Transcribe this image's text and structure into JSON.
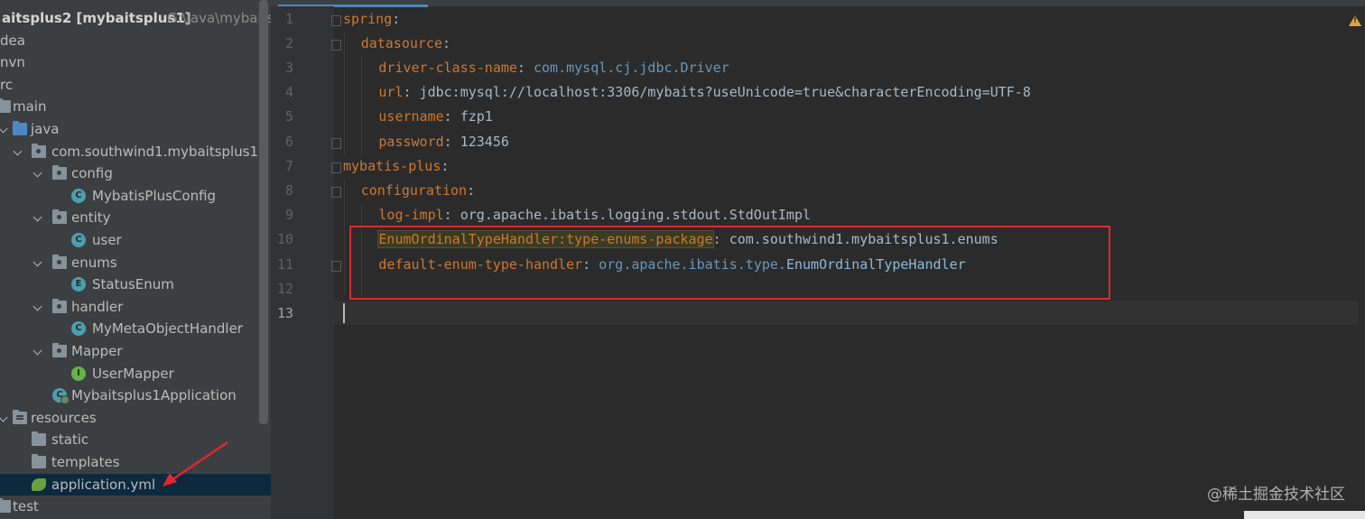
{
  "project_tree": {
    "items": [
      {
        "label": "aitsplus2 [mybaitsplus1]",
        "extra": "G:\\java\\mybaitsp",
        "icon": "module-icon"
      },
      {
        "label": "dea",
        "icon": "folder-icon"
      },
      {
        "label": "nvn",
        "icon": "folder-icon"
      },
      {
        "label": "rc",
        "icon": "folder-icon"
      },
      {
        "label": "main",
        "icon": "folder-icon"
      },
      {
        "label": "java",
        "icon": "source-folder-icon"
      },
      {
        "label": "com.southwind1.mybaitsplus1",
        "icon": "package-icon"
      },
      {
        "label": "config",
        "icon": "package-icon"
      },
      {
        "label": "MybatisPlusConfig",
        "icon": "class-icon",
        "badge": "C"
      },
      {
        "label": "entity",
        "icon": "package-icon"
      },
      {
        "label": "user",
        "icon": "class-icon",
        "badge": "C"
      },
      {
        "label": "enums",
        "icon": "package-icon"
      },
      {
        "label": "StatusEnum",
        "icon": "enum-icon",
        "badge": "E"
      },
      {
        "label": "handler",
        "icon": "package-icon"
      },
      {
        "label": "MyMetaObjectHandler",
        "icon": "class-icon",
        "badge": "C"
      },
      {
        "label": "Mapper",
        "icon": "package-icon"
      },
      {
        "label": "UserMapper",
        "icon": "interface-icon",
        "badge": "I"
      },
      {
        "label": "Mybaitsplus1Application",
        "icon": "spring-app-class-icon",
        "badge": "C"
      },
      {
        "label": "resources",
        "icon": "resources-folder-icon"
      },
      {
        "label": "static",
        "icon": "folder-icon"
      },
      {
        "label": "templates",
        "icon": "folder-icon"
      },
      {
        "label": "application.yml",
        "icon": "yaml-file-icon"
      },
      {
        "label": "test",
        "icon": "folder-icon"
      }
    ]
  },
  "editor": {
    "line_numbers": [
      "1",
      "2",
      "3",
      "4",
      "5",
      "6",
      "7",
      "8",
      "9",
      "10",
      "11",
      "12",
      "13"
    ],
    "lines": [
      {
        "key": "spring",
        "sep": ":",
        "value": ""
      },
      {
        "key": "datasource",
        "sep": ":",
        "value": ""
      },
      {
        "key": "driver-class-name",
        "sep": ": ",
        "value": "com.mysql.cj.jdbc.Driver"
      },
      {
        "key": "url",
        "sep": ": ",
        "value": "jdbc:mysql://localhost:3306/mybaits?useUnicode=true&characterEncoding=UTF-8"
      },
      {
        "key": "username",
        "sep": ": ",
        "value": "fzp1"
      },
      {
        "key": "password",
        "sep": ": ",
        "value": "123456"
      },
      {
        "key": "mybatis-plus",
        "sep": ":",
        "value": ""
      },
      {
        "key": "configuration",
        "sep": ":",
        "value": ""
      },
      {
        "key": "log-impl",
        "sep": ": ",
        "value": "org.apache.ibatis.logging.stdout.StdOutImpl"
      },
      {
        "key": "EnumOrdinalTypeHandler:type-enums-package",
        "sep": ": ",
        "value": "com.southwind1.mybaitsplus1.enums"
      },
      {
        "key": "default-enum-type-handler",
        "sep": ": ",
        "value": "org.apache.ibatis.type.",
        "value_class": "EnumOrdinalTypeHandler"
      },
      {
        "key": "",
        "sep": "",
        "value": ""
      },
      {
        "key": "",
        "sep": "",
        "value": ""
      }
    ]
  },
  "watermark": "@稀土掘金技术社区",
  "colors": {
    "key": "#cc7832",
    "value": "#a9b7c6",
    "class_ref": "#6897bb",
    "annotation_red": "#e0282e",
    "selection": "#0d293e"
  }
}
